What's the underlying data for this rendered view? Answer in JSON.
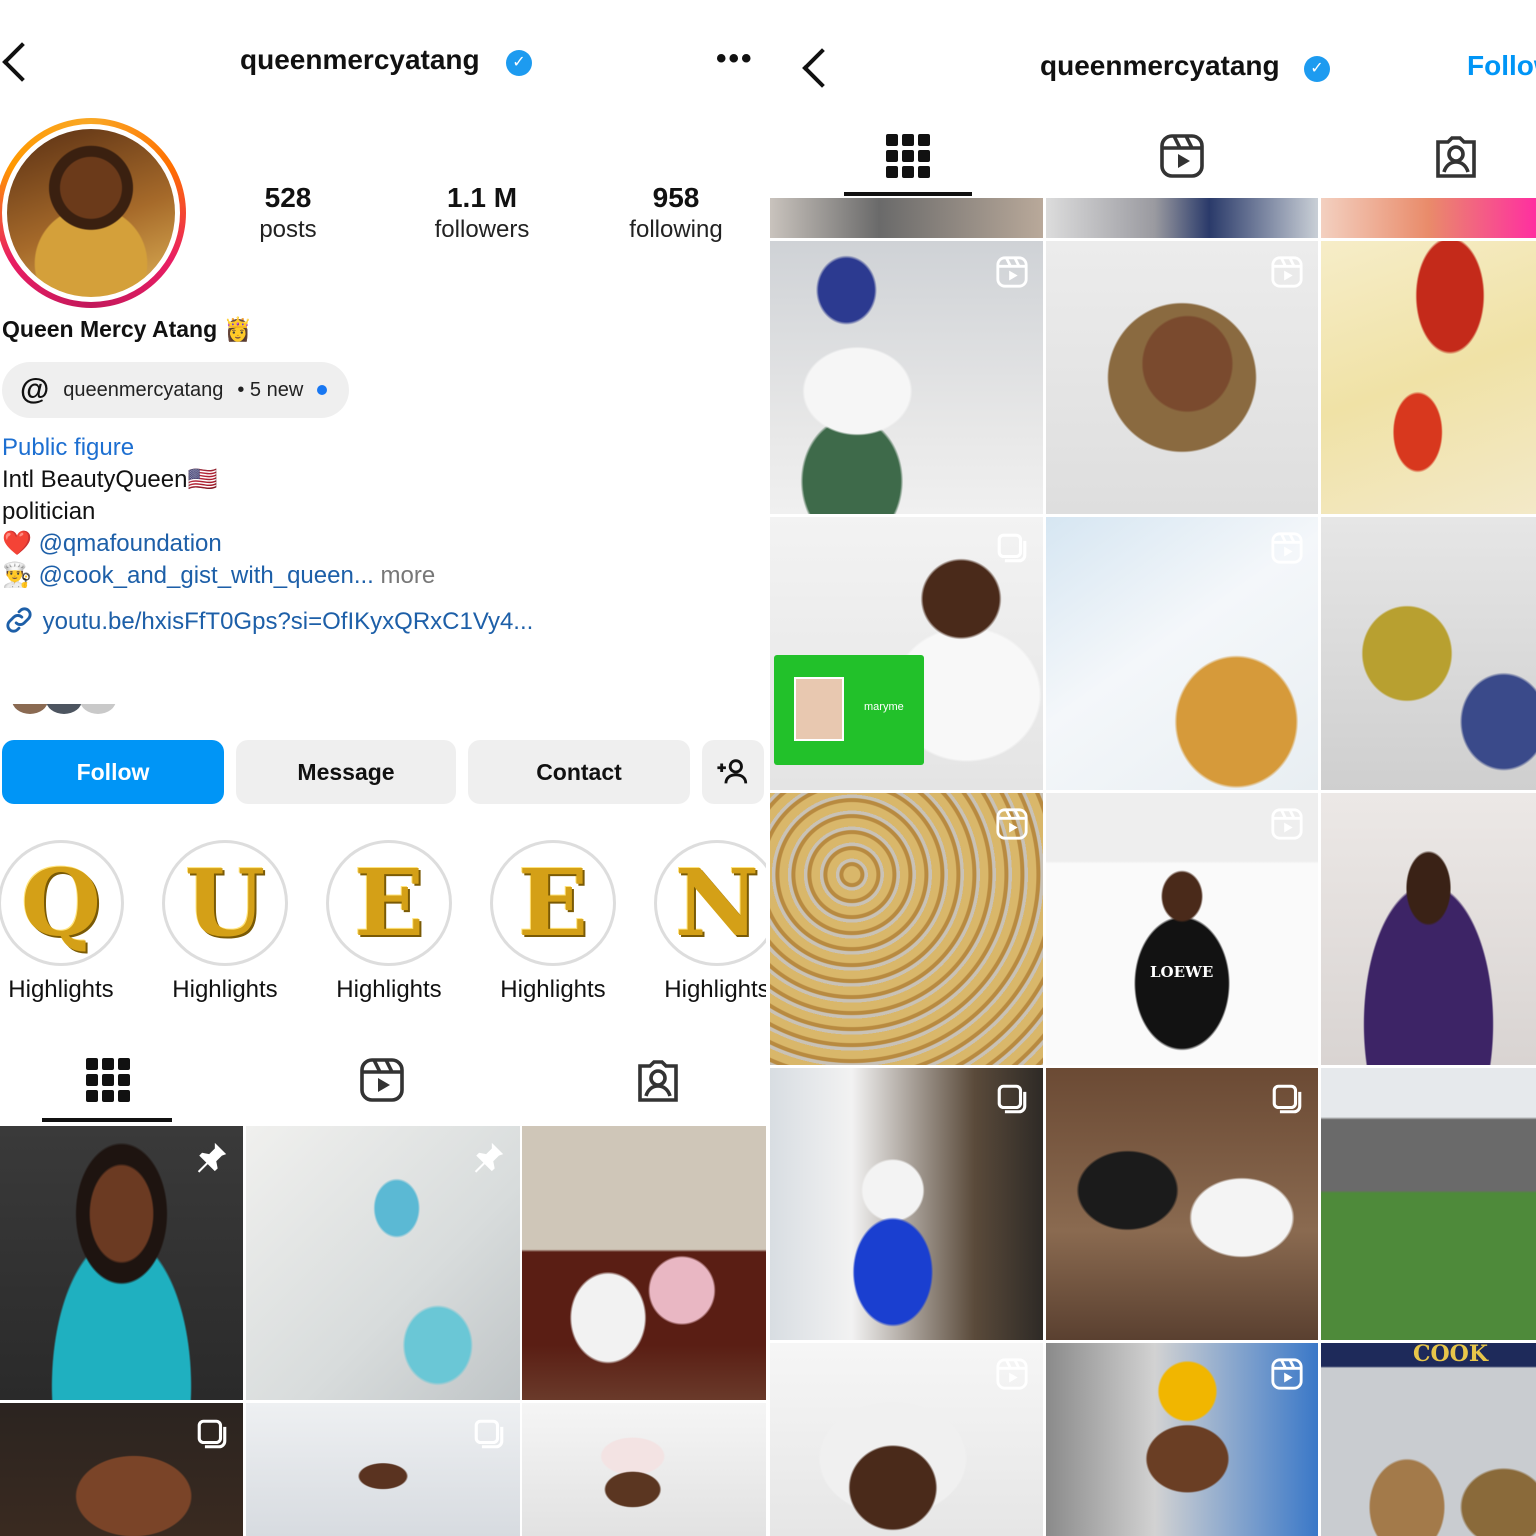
{
  "left": {
    "header": {
      "handle": "queenmercyatang",
      "verified_icon": "verified-badge",
      "more_label": "•••"
    },
    "stats": [
      {
        "value": "528",
        "label": "posts"
      },
      {
        "value": "1.1 M",
        "label": "followers"
      },
      {
        "value": "958",
        "label": "following"
      }
    ],
    "display_name": "Queen Mercy Atang 👸",
    "threads": {
      "handle": "queenmercyatang",
      "new_count": "• 5 new"
    },
    "bio": {
      "category": "Public figure",
      "line1": "Intl BeautyQueen🇺🇸",
      "line2": "politician",
      "mention1_prefix": "❤️",
      "mention1": "@qmafoundation",
      "mention2_prefix": "👨‍🍳",
      "mention2": "@cook_and_gist_with_queen...",
      "more": "more",
      "link": "youtu.be/hxisFfT0Gps?si=OfIKyxQRxC1Vy4..."
    },
    "buttons": {
      "follow": "Follow",
      "message": "Message",
      "contact": "Contact"
    },
    "highlights": [
      {
        "letter": "Q",
        "label": "Highlights"
      },
      {
        "letter": "U",
        "label": "Highlights"
      },
      {
        "letter": "E",
        "label": "Highlights"
      },
      {
        "letter": "E",
        "label": "Highlights"
      },
      {
        "letter": "N",
        "label": "Highlights"
      }
    ]
  },
  "right": {
    "header": {
      "handle": "queenmercyatang",
      "follow": "Follow"
    },
    "tile_badges": {
      "row1": [
        "reel-icon",
        "reel-icon",
        ""
      ],
      "row2": [
        "carousel-icon",
        "reel-icon",
        ""
      ],
      "row3": [
        "reel-icon",
        "reel-icon",
        ""
      ],
      "row4": [
        "carousel-icon",
        "carousel-icon",
        ""
      ],
      "row5": [
        "reel-icon",
        "reel-icon",
        ""
      ]
    },
    "tile_texts": {
      "loewe": "LOEWE",
      "cook_sign": "COOK",
      "bag_brand": "maryme"
    }
  },
  "colors": {
    "accent": "#0095f6",
    "link": "#1d5fa8",
    "verified": "#1d9bf0",
    "pill": "#efefef"
  }
}
